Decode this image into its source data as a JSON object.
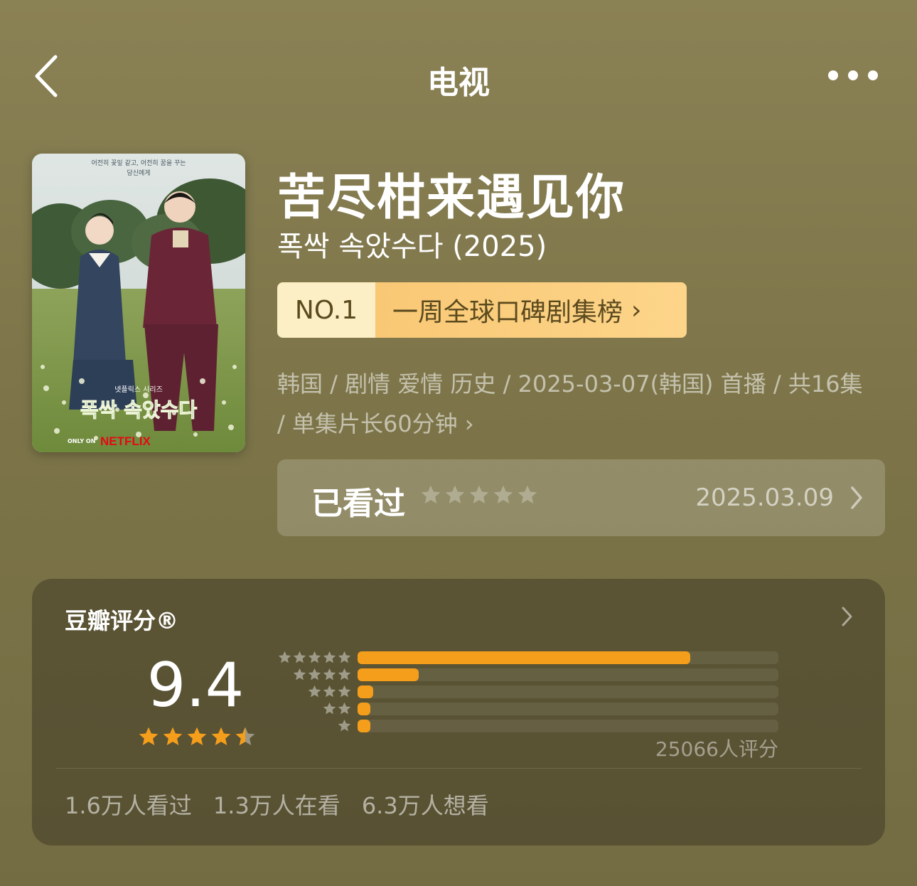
{
  "nav": {
    "title": "电视"
  },
  "show": {
    "title": "苦尽柑来遇见你",
    "subtitle": "폭싹 속았수다 (2025)",
    "poster": {
      "top_caption": "어전히 꽃잎 같고, 어전히 꿈을 꾸는",
      "top_caption2": "당신에게",
      "korean_title": "폭싹 속았수다",
      "series_label": "넷플릭스 시리즈",
      "only_on": "ONLY ON",
      "brand": "NETFLIX"
    }
  },
  "rank": {
    "no": "NO.1",
    "label": "一周全球口碑剧集榜",
    "chevron": "›"
  },
  "meta": {
    "text": "韩国 / 剧情 爱情 历史 / 2025-03-07(韩国) 首播 / 共16集 / 单集片长60分钟",
    "chevron": "›"
  },
  "watched": {
    "label": "已看过",
    "date": "2025.03.09",
    "user_rating": 0
  },
  "rating": {
    "title": "豆瓣评分®",
    "score": "9.4",
    "stars": 4.5,
    "count": "25066人评分",
    "distribution": [
      {
        "stars": 5,
        "fraction": 0.79
      },
      {
        "stars": 4,
        "fraction": 0.146
      },
      {
        "stars": 3,
        "fraction": 0.037
      },
      {
        "stars": 2,
        "fraction": 0.028
      },
      {
        "stars": 1,
        "fraction": 0.028
      }
    ]
  },
  "stats": {
    "watched": "1.6万人看过",
    "watching": "1.3万人在看",
    "want": "6.3万人想看"
  },
  "colors": {
    "accent_orange": "#f59e1b",
    "rank_light": "#fcefc6",
    "rank_dark": "#f9c875"
  }
}
